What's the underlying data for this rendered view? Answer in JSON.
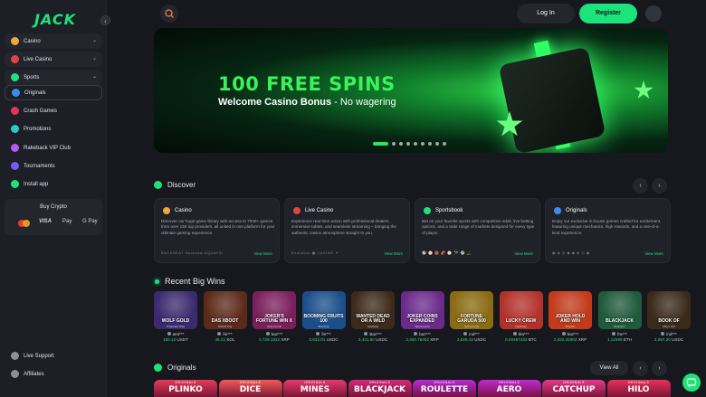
{
  "brand": {
    "logo": "JACK",
    "accent": "#1ee37a"
  },
  "sidebar": {
    "collapse_icon": "‹",
    "groups": [
      {
        "label": "Casino",
        "icon": "casino-icon",
        "expandable": true
      },
      {
        "label": "Live Casino",
        "icon": "live-casino-icon",
        "expandable": true
      },
      {
        "label": "Sports",
        "icon": "sports-icon",
        "expandable": true
      }
    ],
    "links": [
      {
        "label": "Originals",
        "icon": "originals-icon",
        "active": true
      },
      {
        "label": "Crash Games",
        "icon": "crash-icon"
      },
      {
        "label": "Promotions",
        "icon": "promotions-icon"
      }
    ],
    "extras": [
      {
        "label": "Rakeback VIP Club",
        "icon": "vip-icon"
      },
      {
        "label": "Tournaments",
        "icon": "trophy-icon"
      },
      {
        "label": "Install app",
        "icon": "download-icon"
      }
    ],
    "buy_crypto": {
      "title": "Buy Crypto",
      "methods": [
        "VISA",
        "Pay",
        "G Pay"
      ]
    },
    "bottom": [
      {
        "label": "Live Support",
        "icon": "support-icon"
      },
      {
        "label": "Affiliates",
        "icon": "affiliates-icon"
      }
    ]
  },
  "topbar": {
    "login": "Log In",
    "register": "Register"
  },
  "banner": {
    "headline": "100 FREE SPINS",
    "sub_bold": "Welcome Casino Bonus",
    "sub_rest": " - No wagering",
    "slides": 9,
    "active_slide": 1
  },
  "discover": {
    "title": "Discover",
    "more": "View More",
    "cards": [
      {
        "title": "Casino",
        "icon": "casino-icon",
        "color": "#f2a63b",
        "desc": "Discover our huge game library with access to 7000+ games from over 150 top providers, all united in one platform for your ultimate gaming experience.",
        "logos": "BACKSEAT   Hacksaw   AQUATIC"
      },
      {
        "title": "Live Casino",
        "icon": "live-icon",
        "color": "#e0443f",
        "desc": "Experience real-time action with professional dealers, immersive tables, and seamless streaming – bringing the authentic casino atmosphere straight to you.",
        "logos": "Evolution   ▣   CASINO   ✦"
      },
      {
        "title": "Sportsbook",
        "icon": "sportsbook-icon",
        "color": "#1ee37a",
        "desc": "Bet on your favorite sports with competitive odds, live betting options, and a wide range of markets designed for every type of player.",
        "logos": "⚽ ⚾ 🏀 🏈 ⚾ 🎾 ⚽ 🏒"
      },
      {
        "title": "Originals",
        "icon": "originals-icon",
        "color": "#3b8cf2",
        "desc": "Enjoy our exclusive in-house games crafted for excitement, featuring unique mechanics, high rewards, and a one-of-a-kind experience.",
        "logos": "◉ ◈ ◎ ◆ ◉ ◈ ◎ ◆"
      }
    ]
  },
  "wins": {
    "title": "Recent Big Wins",
    "items": [
      {
        "game": "WOLF GOLD",
        "provider": "Pragmatic Play",
        "user": "ami***",
        "amount": "100.12",
        "cur": "USDT",
        "bg": "#3b2a6e"
      },
      {
        "game": "DAS XBOOT",
        "provider": "Nolimit City",
        "user": "fin***",
        "amount": "45.22",
        "cur": "SOL",
        "bg": "#5c2a1a"
      },
      {
        "game": "JOKER'S FORTUNE WIN X",
        "provider": "Spinomenal",
        "user": "baz***",
        "amount": "2,728.1812",
        "cur": "XRP",
        "bg": "#7a1f5c"
      },
      {
        "game": "BOOMING FRUITS 100",
        "provider": "Booming",
        "user": "fin***",
        "amount": "3,633.01",
        "cur": "USDC",
        "bg": "#1a4e8a"
      },
      {
        "game": "WANTED DEAD OR A WILD",
        "provider": "Hacksaw",
        "user": "Baz***",
        "amount": "3,431.80",
        "cur": "USDC",
        "bg": "#3d2a1a"
      },
      {
        "game": "JOKER COINS EXPANDED",
        "provider": "Spinomenal",
        "user": "baz***",
        "amount": "2,400.78402",
        "cur": "XRP",
        "bg": "#6a2a8a"
      },
      {
        "game": "FORTUNE GARUDA 500",
        "provider": "Spinomenal",
        "user": "ind***",
        "amount": "3,028.43",
        "cur": "USDC",
        "bg": "#8a6a12"
      },
      {
        "game": "LUCKY CREW",
        "provider": "Hacksaw",
        "user": "bla***",
        "amount": "0.03487433",
        "cur": "BTC",
        "bg": "#b2322a"
      },
      {
        "game": "JOKER HOLD AND WIN",
        "provider": "Playson",
        "user": "baz***",
        "amount": "2,022.32002",
        "cur": "XRP",
        "bg": "#c23a1a"
      },
      {
        "game": "BLACKJACK",
        "provider": "Evolution",
        "user": "fra***",
        "amount": "1.12369",
        "cur": "ETH",
        "bg": "#1f5a3a"
      },
      {
        "game": "BOOK OF",
        "provider": "Play'n GO",
        "user": "ind***",
        "amount": "2,087.20",
        "cur": "USDC",
        "bg": "#3a2a1a"
      }
    ]
  },
  "originals": {
    "title": "Originals",
    "view_all": "View All",
    "kicker": "ORIGINALS",
    "games": [
      {
        "name": "PLINKO",
        "bg": "#e83a5a"
      },
      {
        "name": "DICE",
        "bg": "#f25a5a"
      },
      {
        "name": "MINES",
        "bg": "#e83a6a"
      },
      {
        "name": "BLACKJACK",
        "bg": "#d62a7a"
      },
      {
        "name": "ROULETTE",
        "bg": "#b82ad6"
      },
      {
        "name": "AERO",
        "bg": "#c22ad0"
      },
      {
        "name": "CATCHUP",
        "bg": "#e83a8a"
      },
      {
        "name": "HILO",
        "bg": "#e8325a"
      }
    ]
  }
}
